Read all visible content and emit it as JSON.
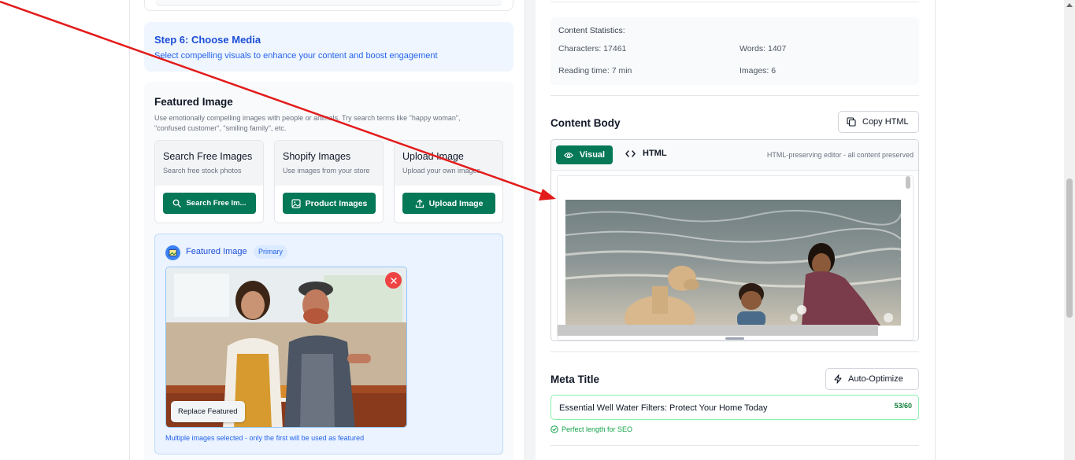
{
  "step": {
    "title": "Step 6: Choose Media",
    "description": "Select compelling visuals to enhance your content and boost engagement"
  },
  "featured": {
    "title": "Featured Image",
    "description": "Use emotionally compelling images with people or animals. Try search terms like \"happy woman\", \"confused customer\", \"smiling family\", etc.",
    "options": [
      {
        "title": "Search Free Images",
        "subtitle": "Search free stock photos",
        "button": "Search Free Im..."
      },
      {
        "title": "Shopify Images",
        "subtitle": "Use images from your store",
        "button": "Product Images"
      },
      {
        "title": "Upload Image",
        "subtitle": "Upload your own images",
        "button": "Upload Image"
      }
    ],
    "preview": {
      "label": "Featured Image",
      "badge": "Primary",
      "replace_button": "Replace Featured",
      "note": "Multiple images selected - only the first will be used as featured"
    }
  },
  "stats": {
    "title": "Content Statistics:",
    "characters": "Characters: 17461",
    "words": "Words: 1407",
    "reading_time": "Reading time: 7 min",
    "images": "Images: 6"
  },
  "content_body": {
    "title": "Content Body",
    "copy_button": "Copy HTML",
    "tabs": {
      "visual": "Visual",
      "html": "HTML"
    },
    "editor_note": "HTML-preserving editor - all content preserved"
  },
  "meta_title": {
    "title": "Meta Title",
    "optimize_button": "Auto-Optimize",
    "value": "Essential Well Water Filters: Protect Your Home Today",
    "count": "53/60",
    "hint": "Perfect length for SEO"
  },
  "colors": {
    "accent_green": "#047857",
    "info_blue": "#1d4ed8",
    "danger_red": "#ef4444",
    "annotation_red": "#e31b1b"
  }
}
